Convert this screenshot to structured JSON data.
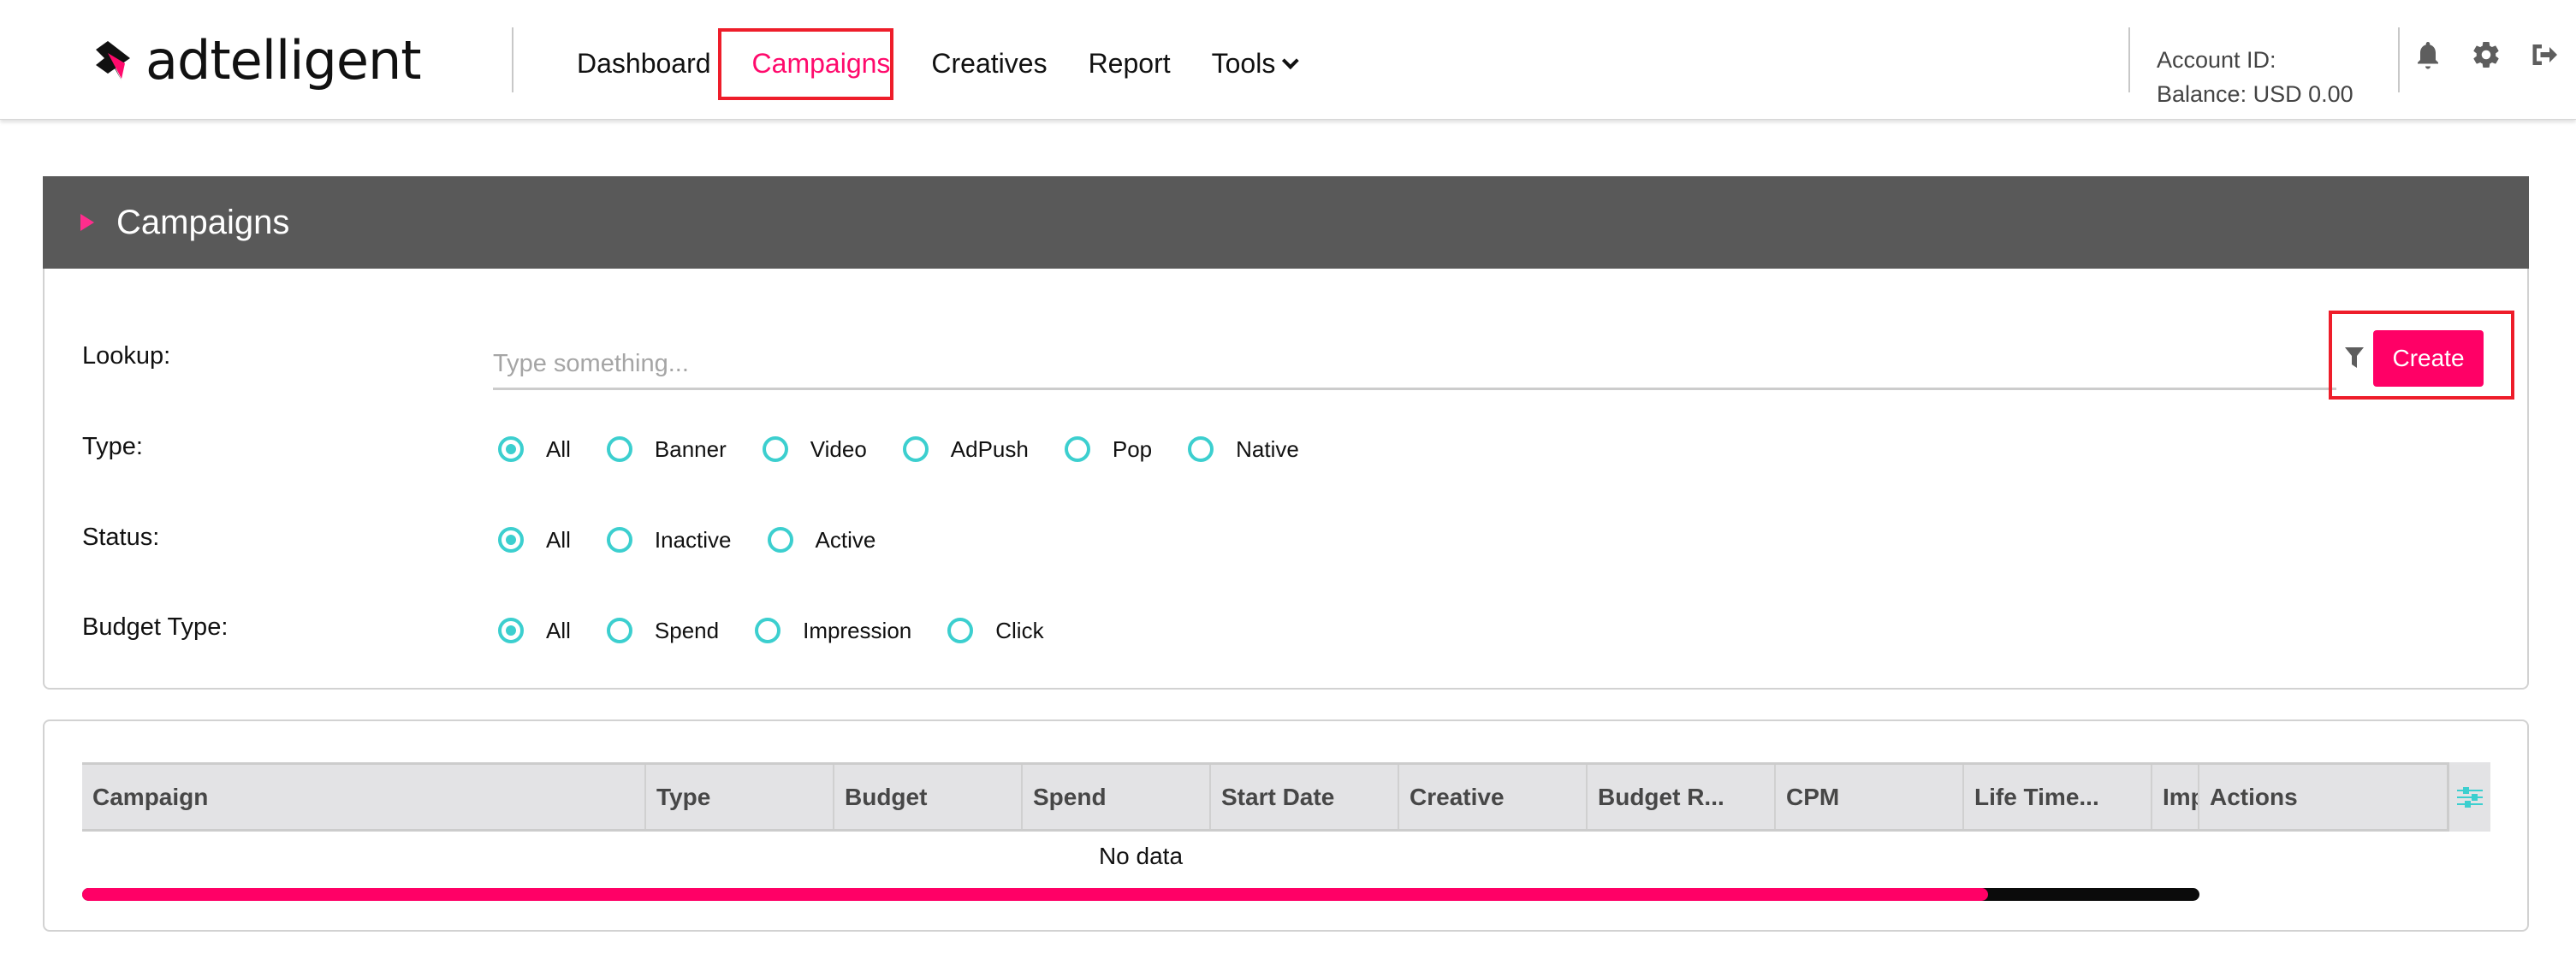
{
  "brand": {
    "name": "adtelligent",
    "accent": "#ff0066",
    "radio_color": "#3ccfcf"
  },
  "nav": {
    "items": [
      {
        "label": "Dashboard",
        "active": false
      },
      {
        "label": "Campaigns",
        "active": true
      },
      {
        "label": "Creatives",
        "active": false
      },
      {
        "label": "Report",
        "active": false
      },
      {
        "label": "Tools",
        "active": false,
        "has_dropdown": true
      }
    ]
  },
  "account": {
    "id_label": "Account ID:",
    "id_value": "",
    "balance_label": "Balance: USD 0.00"
  },
  "header_icons": [
    "bell-icon",
    "gear-icon",
    "logout-icon"
  ],
  "panel": {
    "title": "Campaigns",
    "lookup": {
      "label": "Lookup:",
      "value": "",
      "placeholder": "Type something..."
    },
    "create_label": "Create",
    "filters": {
      "type": {
        "label": "Type:",
        "options": [
          "All",
          "Banner",
          "Video",
          "AdPush",
          "Pop",
          "Native"
        ],
        "selected": "All"
      },
      "status": {
        "label": "Status:",
        "options": [
          "All",
          "Inactive",
          "Active"
        ],
        "selected": "All"
      },
      "budget_type": {
        "label": "Budget Type:",
        "options": [
          "All",
          "Spend",
          "Impression",
          "Click"
        ],
        "selected": "All"
      }
    }
  },
  "table": {
    "columns": [
      "Campaign",
      "Type",
      "Budget",
      "Spend",
      "Start Date",
      "Creative",
      "Budget R...",
      "CPM",
      "Life Time...",
      "Imp",
      "Actions"
    ],
    "rows": [],
    "empty_text": "No data",
    "scroll_position_fraction": 0.9
  }
}
